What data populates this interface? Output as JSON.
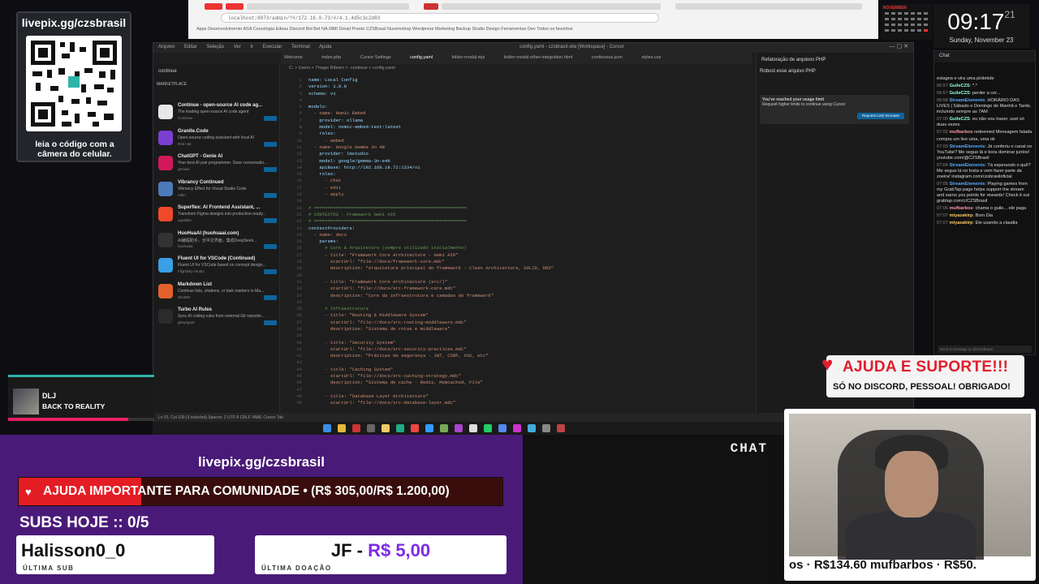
{
  "qr_card": {
    "url": "livepix.gg/czsbrasil",
    "caption": "leia o código com a câmera do celular."
  },
  "browser": {
    "url": "localhost:8073/admin/?#/172.16.0.73/#/4.1.4d5c3c2d83",
    "bookmarks": "Apps  Desenvolvimento  ASA Cursologia  Edeas  Discord  Bol  Bet  NA.MMI  Gmail  Presto  CZSBrasil  Nuvemshop  Wordpress  Marketing  Backup  Studio  Design  Ferramentas  Dev  Todos os favoritos"
  },
  "clock": {
    "time": "09:17",
    "seconds": "21",
    "date": "Sunday, November 23",
    "month": "NOVEMBER"
  },
  "ide": {
    "menus": [
      "Arquivo",
      "Editar",
      "Seleção",
      "Ver",
      "Ir",
      "Executar",
      "Terminal",
      "Ajuda"
    ],
    "window_title": "config.yaml - czsbrasil-site [Workspace] - Cursor",
    "sidebar_header": "continue",
    "sidebar_section": "MARKETPLACE",
    "extensions": [
      {
        "name": "Continue - open-source AI code ag...",
        "desc": "The leading open-source AI code agent",
        "pub": "Continue",
        "color": "#e8e8e8"
      },
      {
        "name": "Granite.Code",
        "desc": "Open-source coding assistant with local AI",
        "pub": "Red Hat",
        "color": "#7b3fd1"
      },
      {
        "name": "ChatGPT - Genie AI",
        "desc": "Your best AI pair programmer. Save conversatio...",
        "pub": "genieai",
        "color": "#d1195a"
      },
      {
        "name": "Vibrancy Continued",
        "desc": "Vibrancy Effect for Visual Studio Code",
        "pub": "Iobin",
        "color": "#4d7ab8"
      },
      {
        "name": "Superflex: AI Frontend Assistant, ...",
        "desc": "Transform Figma designs into production-ready...",
        "pub": "aquilabs",
        "color": "#f04a2b"
      },
      {
        "name": "HuoHuaAI (huohuaai.com)",
        "desc": "AI编程助手，全中文界面，集成DeepSeek...",
        "pub": "huohuaai",
        "color": "#333"
      },
      {
        "name": "Fluent UI for VSCode (Continued)",
        "desc": "Fluent UI for VSCode based on concept design...",
        "pub": "FlightSky-Studio",
        "color": "#3aa0e6"
      },
      {
        "name": "Markdown List",
        "desc": "Continue lists, citations, or task markers in Ma...",
        "pub": "WhiNM",
        "color": "#e2612c"
      },
      {
        "name": "Turbo AI Rules",
        "desc": "Sync AI coding rules from external Git reposito...",
        "pub": "gkeyegoal",
        "color": "#2b2b2b"
      }
    ],
    "tabs": [
      "Welcome",
      "index.php",
      "Cursor Settings",
      "config.yaml",
      "folder-modal.mjs",
      "folder-modal-other-integration.html",
      "continuous.json",
      "styles.css"
    ],
    "active_tab": "config.yaml",
    "breadcrumb": "C: > Users > Thiago Ribeiro > .continue > config.yaml",
    "code": [
      {
        "n": "1",
        "t": "name: Local Config"
      },
      {
        "n": "2",
        "t": "version: 1.0.0"
      },
      {
        "n": "3",
        "t": "schema: v1"
      },
      {
        "n": "4",
        "t": ""
      },
      {
        "n": "5",
        "t": "models:"
      },
      {
        "n": "6",
        "t": "  - name: Nomic Embed"
      },
      {
        "n": "7",
        "t": "    provider: ollama"
      },
      {
        "n": "8",
        "t": "    model: nomic-embed-text:latest"
      },
      {
        "n": "9",
        "t": "    roles:"
      },
      {
        "n": "10",
        "t": "      - embed"
      },
      {
        "n": "11",
        "t": "  - name: Google Gemma 3n 4B"
      },
      {
        "n": "12",
        "t": "    provider: lmstudio"
      },
      {
        "n": "13",
        "t": "    model: google/gemma-3n-e4b"
      },
      {
        "n": "14",
        "t": "    apiBase: http://192.168.18.72:1234/v1"
      },
      {
        "n": "15",
        "t": "    roles:"
      },
      {
        "n": "16",
        "t": "      - chat"
      },
      {
        "n": "17",
        "t": "      - edit"
      },
      {
        "n": "18",
        "t": "      - apply"
      },
      {
        "n": "19",
        "t": ""
      },
      {
        "n": "20",
        "t": "# ========================================================"
      },
      {
        "n": "21",
        "t": "# CONTEXTOS - Framework Gemi AIO"
      },
      {
        "n": "22",
        "t": "# ========================================================"
      },
      {
        "n": "23",
        "t": "contextProviders:"
      },
      {
        "n": "24",
        "t": "  - name: docs"
      },
      {
        "n": "25",
        "t": "    params:"
      },
      {
        "n": "26",
        "t": "      # Core & Arquitetura (sempre utilizado inicialmente)"
      },
      {
        "n": "27",
        "t": "      - title: \"Framework Core Architecture - Gemi AIO\""
      },
      {
        "n": "28",
        "t": "        startUrl: \"file://docs/framework-core.mdc\""
      },
      {
        "n": "29",
        "t": "        description: \"Arquitetura principal do framework - Clean Architecture, SOLID, DDD\""
      },
      {
        "n": "30",
        "t": ""
      },
      {
        "n": "31",
        "t": "      - title: \"Framework Core Architecture (src/)\""
      },
      {
        "n": "32",
        "t": "        startUrl: \"file://docs/src-framework-core.mdc\""
      },
      {
        "n": "33",
        "t": "        description: \"Core da infraestrutura e camadas do framework\""
      },
      {
        "n": "34",
        "t": ""
      },
      {
        "n": "35",
        "t": "      # Infraestrutura"
      },
      {
        "n": "36",
        "t": "      - title: \"Routing & Middleware System\""
      },
      {
        "n": "37",
        "t": "        startUrl: \"file://docs/src-routing-middleware.mdc\""
      },
      {
        "n": "38",
        "t": "        description: \"Sistema de rotas e middleware\""
      },
      {
        "n": "39",
        "t": ""
      },
      {
        "n": "40",
        "t": "      - title: \"Security System\""
      },
      {
        "n": "41",
        "t": "        startUrl: \"file://docs/src-security-practices.mdc\""
      },
      {
        "n": "42",
        "t": "        description: \"Práticas de segurança - JWT, CSRF, XSS, etc\""
      },
      {
        "n": "43",
        "t": ""
      },
      {
        "n": "44",
        "t": "      - title: \"Caching System\""
      },
      {
        "n": "45",
        "t": "        startUrl: \"file://docs/src-caching-strategy.mdc\""
      },
      {
        "n": "46",
        "t": "        description: \"Sistema de cache - Redis, Memcached, File\""
      },
      {
        "n": "47",
        "t": ""
      },
      {
        "n": "48",
        "t": "      - title: \"Database Layer Architecture\""
      },
      {
        "n": "49",
        "t": "        startUrl: \"file://docs/src-database-layer.mdc\""
      }
    ],
    "chat_panel": {
      "title": "Refatoração de arquivos PHP",
      "question": "Robust esse arquivo PHP",
      "limit_title": "You've reached your usage limit",
      "limit_text": "Request higher limits to continue using Cursor",
      "limit_button": "Request Limit Increase"
    },
    "status": "Ln 91, Col 100 (3 selected)   Spaces: 2   UTF-8   CRLF   YAML   Cursor Tab"
  },
  "chat": {
    "header": "Chat",
    "lines": [
      {
        "t": "",
        "u": "",
        "m": "estagna e vira uma pirâmide",
        "c": "#ddd"
      },
      {
        "t": "06:57",
        "u": "GuileCZS",
        "m": ": *.*",
        "c": "#8fd"
      },
      {
        "t": "06:57",
        "u": "GuileCZS",
        "m": ": perder a cor...",
        "c": "#8fd"
      },
      {
        "t": "06:58",
        "u": "StreamElements",
        "m": ": HORÁRIO DAS LIVES | Sábado e Domingo de Manhã e Tarde, incluindo sempre as 7AM",
        "c": "#5af"
      },
      {
        "t": "07:00",
        "u": "GuileCZS",
        "m": ": eu não vou trazer, usei só duas vezes.",
        "c": "#8fd"
      },
      {
        "t": "07:02",
        "u": "mufbarbos",
        "m": " redeemed Mensagem falada",
        "c": "#f9a"
      },
      {
        "t": "",
        "u": "",
        "m": "compra um live uma, uma ok",
        "c": "#ddd"
      },
      {
        "t": "07:03",
        "u": "StreamElements",
        "m": ": Já conferiu o canal no YouTube? Me segue lá e bora dominar juntos! youtube.com/@CZSBrasil",
        "c": "#5af"
      },
      {
        "t": "07:04",
        "u": "StreamElements",
        "m": ": Tá esperando o quê? Me segue lá no Insta e vem fazer parte da zoeira! instagram.com/czsbrasiloficial",
        "c": "#5af"
      },
      {
        "t": "07:05",
        "u": "StreamElements",
        "m": ": Playing games from my GrabTap page helps support the stream and earns you points for rewards! Check it out grabtap.com/c/CZSBrasil",
        "c": "#5af"
      },
      {
        "t": "07:06",
        "u": "mufbarbos",
        "m": ": chama o guile... ele paga",
        "c": "#f9a"
      },
      {
        "t": "07:07",
        "u": "miyazakirp",
        "m": ": Bom Dia",
        "c": "#fc6"
      },
      {
        "t": "07:07",
        "u": "miyazakirp",
        "m": ": Ele usando a claudia",
        "c": "#fc6"
      }
    ],
    "input_placeholder": "Send a message to @CZSBrasil"
  },
  "music": {
    "artist": "DLJ",
    "track": "BACK TO REALITY",
    "progress": 0.82
  },
  "help_banner": {
    "title": "AJUDA E SUPORTE!!!",
    "subtitle": "SÓ NO DISCORD, PESSOAL! OBRIGADO!"
  },
  "overlay": {
    "livepix": "livepix.gg/czsbrasil",
    "goal_text": "AJUDA IMPORTANTE PARA COMUNIDADE  •  (R$ 305,00/R$ 1.200,00)",
    "goal_current": 305,
    "goal_total": 1200,
    "subs_today": "SUBS HOJE :: 0/5",
    "last_sub_name": "Halisson0_0",
    "last_sub_label": "ÚLTIMA SUB",
    "last_don_name": "JF - ",
    "last_don_amount": "R$ 5,00",
    "last_don_label": "ÚLTIMA DOAÇÃO",
    "chat_label": "CHAT",
    "ticker": "os · R$134.60    mufbarbos · R$50."
  },
  "colors": {
    "accent_purple": "#4a1a78",
    "goal_red": "#e41c24",
    "help_red": "#e01e2e",
    "teal": "#2fb3a8"
  }
}
